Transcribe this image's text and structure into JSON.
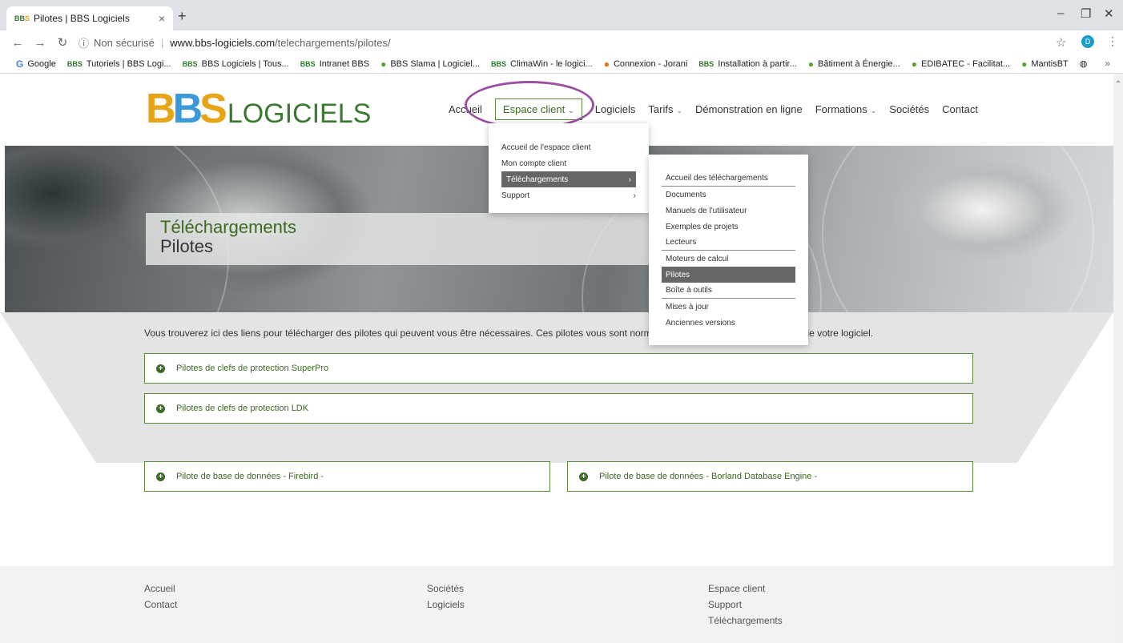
{
  "browser": {
    "tab_title": "Pilotes | BBS Logiciels",
    "tab_close": "×",
    "new_tab": "+",
    "security_label": "Non sécurisé",
    "url_host": "www.bbs-logiciels.com",
    "url_path": "/telechargements/pilotes/",
    "profile_initial": "D",
    "bookmarks": [
      {
        "icon": "G",
        "label": "Google"
      },
      {
        "icon": "BBS",
        "label": "Tutoriels | BBS Logi..."
      },
      {
        "icon": "BBS",
        "label": "BBS Logiciels | Tous..."
      },
      {
        "icon": "BBS",
        "label": "Intranet BBS"
      },
      {
        "icon": "S",
        "label": "BBS Slama | Logiciel..."
      },
      {
        "icon": "BBS",
        "label": "ClimaWin - le logici..."
      },
      {
        "icon": "J",
        "label": "Connexion - Jorani"
      },
      {
        "icon": "BBS",
        "label": "Installation à partir..."
      },
      {
        "icon": "B",
        "label": "Bâtiment à Énergie..."
      },
      {
        "icon": "E",
        "label": "EDIBATEC - Facilitat..."
      },
      {
        "icon": "M",
        "label": "MantisBT"
      }
    ]
  },
  "site": {
    "logo": {
      "b1": "B",
      "b2": "B",
      "s": "S",
      "rest": "LOGICIELS"
    },
    "nav": [
      {
        "label": "Accueil",
        "has_chevron": false
      },
      {
        "label": "Espace client",
        "has_chevron": true,
        "active": true
      },
      {
        "label": "Logiciels",
        "has_chevron": false
      },
      {
        "label": "Tarifs",
        "has_chevron": true
      },
      {
        "label": "Démonstration en ligne",
        "has_chevron": false
      },
      {
        "label": "Formations",
        "has_chevron": true
      },
      {
        "label": "Sociétés",
        "has_chevron": false
      },
      {
        "label": "Contact",
        "has_chevron": false
      }
    ],
    "dropdown_espace_client": [
      {
        "label": "Accueil de l'espace client"
      },
      {
        "label": "Mon compte client"
      },
      {
        "label": "Téléchargements",
        "selected": true,
        "submenu": true
      },
      {
        "label": "Support",
        "submenu": true
      }
    ],
    "dropdown_telechargements": [
      {
        "label": "Accueil des téléchargements",
        "separator": true
      },
      {
        "label": "Documents"
      },
      {
        "label": "Manuels de l'utilisateur"
      },
      {
        "label": "Exemples de projets"
      },
      {
        "label": "Lecteurs",
        "separator": true
      },
      {
        "label": "Moteurs de calcul"
      },
      {
        "label": "Pilotes",
        "selected": true
      },
      {
        "label": "Boîte à outils",
        "separator": true
      },
      {
        "label": "Mises à jour"
      },
      {
        "label": "Anciennes versions"
      }
    ],
    "hero": {
      "title": "Téléchargements",
      "subtitle": "Pilotes"
    },
    "intro_text": "Vous trouverez ici des liens pour télécharger des pilotes qui peuvent vous être nécessaires. Ces pilotes vous sont normalement fournis lors de l'installation de votre logiciel.",
    "accordions": [
      {
        "label": "Pilotes de clefs de protection SuperPro"
      },
      {
        "label": "Pilotes de clefs de protection LDK"
      },
      {
        "label": "Pilote de base de données - Firebird -"
      },
      {
        "label": "Pilote de base de données - Borland Database Engine -"
      }
    ],
    "footer": {
      "col1": [
        "Accueil",
        "Contact"
      ],
      "col2": [
        "Sociétés",
        "Logiciels"
      ],
      "col3": [
        "Espace client",
        "Support",
        "Téléchargements"
      ]
    }
  }
}
